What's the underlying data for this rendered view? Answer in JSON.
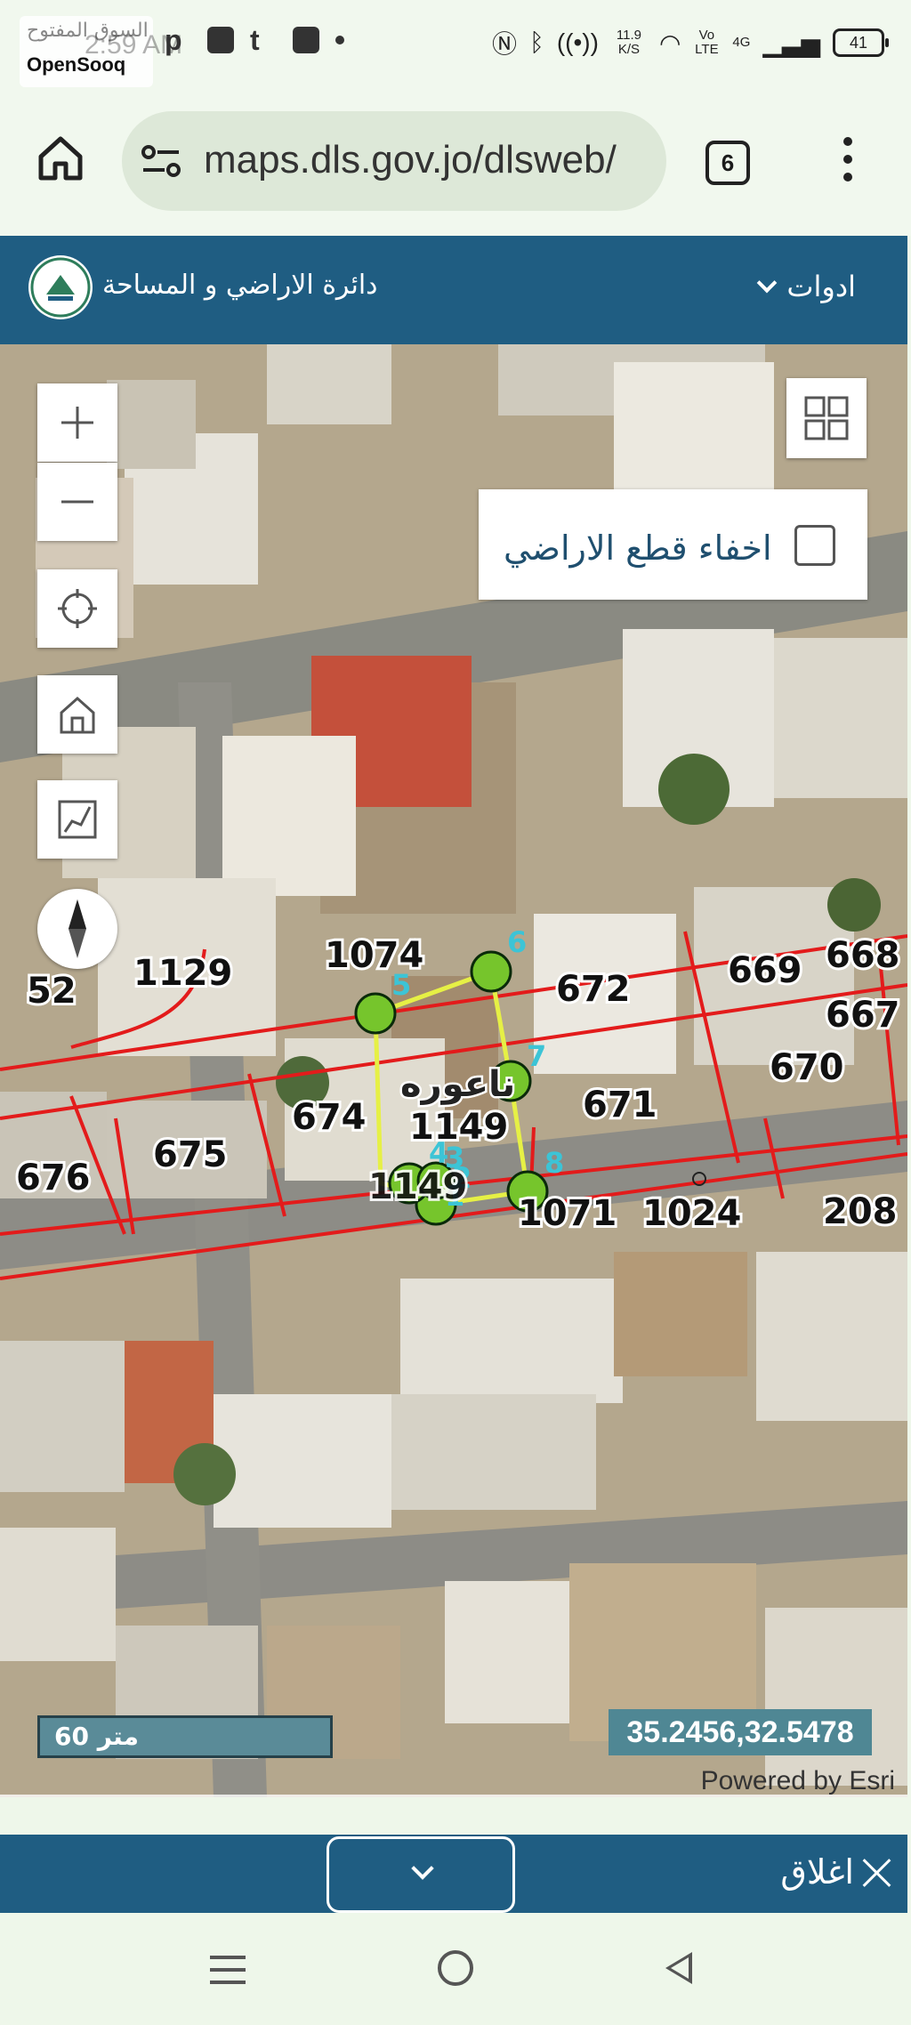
{
  "status_bar": {
    "watermark_ar": "السوق المفتوح",
    "watermark_en": "OpenSooq",
    "time": "2:59 AM",
    "network_speed": "11.9 K/S",
    "volte": "Vo LTE",
    "network": "4G",
    "battery": "41"
  },
  "browser": {
    "url": "maps.dls.gov.jo/dlsweb/",
    "tab_count": "6"
  },
  "app_header": {
    "title": "دائرة الاراضي و المساحة",
    "tools_label": "ادوات"
  },
  "map": {
    "hide_parcels_label": "اخفاء قطع الاراضي",
    "hide_parcels_checked": false,
    "scale_label": "60 متر",
    "coordinates": "35.2456,32.5478",
    "attribution": "Powered by Esri",
    "owner_label": "ناعوره",
    "parcel_numbers": [
      "1074",
      "1129",
      "52",
      "672",
      "669",
      "668",
      "667",
      "670",
      "671",
      "674",
      "1149",
      "675",
      "676",
      "1071",
      "1024",
      "208",
      "1149"
    ],
    "vertex_labels": [
      "5",
      "6",
      "7",
      "8",
      "1",
      "2",
      "3",
      "4"
    ]
  },
  "bottom_bar": {
    "close_label": "اغلاق"
  }
}
